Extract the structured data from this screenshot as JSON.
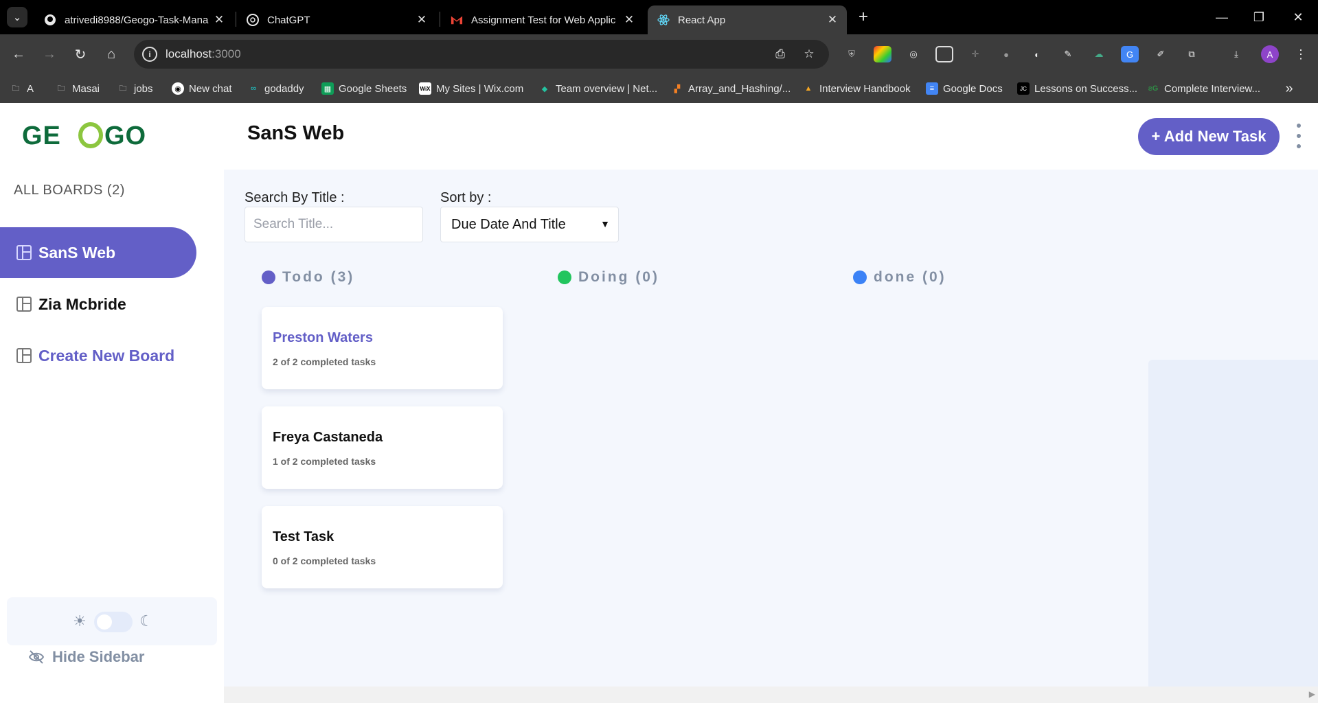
{
  "browser": {
    "tabs": [
      {
        "title": "atrivedi8988/Geogo-Task-Mana",
        "icon": "github-icon"
      },
      {
        "title": "ChatGPT",
        "icon": "chatgpt-icon"
      },
      {
        "title": "Assignment Test for Web Applic",
        "icon": "gmail-icon"
      },
      {
        "title": "React App",
        "icon": "react-icon"
      }
    ],
    "url_host": "localhost",
    "url_port": ":3000",
    "profile_initial": "A",
    "bookmarks": [
      {
        "label": "A",
        "icon": "folder-icon"
      },
      {
        "label": "Masai",
        "icon": "folder-icon"
      },
      {
        "label": "jobs",
        "icon": "folder-icon"
      },
      {
        "label": "New chat",
        "icon": "chatgpt-icon"
      },
      {
        "label": "godaddy",
        "icon": "godaddy-icon"
      },
      {
        "label": "Google Sheets",
        "icon": "sheets-icon"
      },
      {
        "label": "My Sites | Wix.com",
        "icon": "wix-icon"
      },
      {
        "label": "Team overview | Net...",
        "icon": "netlify-icon"
      },
      {
        "label": "Array_and_Hashing/...",
        "icon": "code-icon"
      },
      {
        "label": "Interview Handbook",
        "icon": "handbook-icon"
      },
      {
        "label": "Google Docs",
        "icon": "docs-icon"
      },
      {
        "label": "Lessons on Success...",
        "icon": "jc-icon"
      },
      {
        "label": "Complete Interview...",
        "icon": "gfg-icon"
      }
    ]
  },
  "app": {
    "logo_text": "GEOGO",
    "boards_heading": "ALL BOARDS (2)",
    "boards": [
      {
        "name": "SanS Web",
        "active": true
      },
      {
        "name": "Zia Mcbride",
        "active": false
      }
    ],
    "create_board_label": "Create New Board",
    "hide_sidebar_label": "Hide Sidebar",
    "page_title": "SanS Web",
    "add_task_label": "+ Add New Task",
    "search_label": "Search By Title :",
    "search_placeholder": "Search Title...",
    "sort_label": "Sort by :",
    "sort_value": "Due Date And Title",
    "columns": [
      {
        "name": "Todo (3)",
        "color": "#635fc7"
      },
      {
        "name": "Doing (0)",
        "color": "#22c55e"
      },
      {
        "name": "done (0)",
        "color": "#3b82f6"
      }
    ],
    "tasks": [
      {
        "title": "Preston Waters",
        "subtasks": "2 of 2 completed tasks",
        "highlighted": true
      },
      {
        "title": "Freya Castaneda",
        "subtasks": "1 of 2 completed tasks",
        "highlighted": false
      },
      {
        "title": "Test Task",
        "subtasks": "0 of 2 completed tasks",
        "highlighted": false
      }
    ],
    "accent_color": "#635fc7"
  }
}
